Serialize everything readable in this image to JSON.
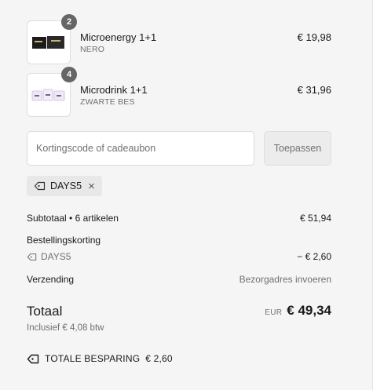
{
  "items": [
    {
      "name": "Microenergy 1+1",
      "variant": "NERO",
      "price": "€ 19,98",
      "quantity": "2",
      "image_icon": "product-box-icon"
    },
    {
      "name": "Microdrink 1+1",
      "variant": "ZWARTE BES",
      "price": "€ 31,96",
      "quantity": "4",
      "image_icon": "product-bag-icon"
    }
  ],
  "discount": {
    "placeholder": "Kortingscode of cadeaubon",
    "value": "",
    "apply_label": "Toepassen",
    "applied_code": "DAYS5"
  },
  "summary": {
    "subtotal_label": "Subtotaal • 6 artikelen",
    "subtotal_value": "€ 51,94",
    "order_discount_label": "Bestellingskorting",
    "order_discount_code": "DAYS5",
    "order_discount_value": "− € 2,60",
    "shipping_label": "Verzending",
    "shipping_value": "Bezorgadres invoeren",
    "total_label": "Totaal",
    "total_currency": "EUR",
    "total_value": "€ 49,34",
    "tax_note": "Inclusief € 4,08 btw",
    "savings_label": "TOTALE BESPARING",
    "savings_value": "€ 2,60"
  }
}
